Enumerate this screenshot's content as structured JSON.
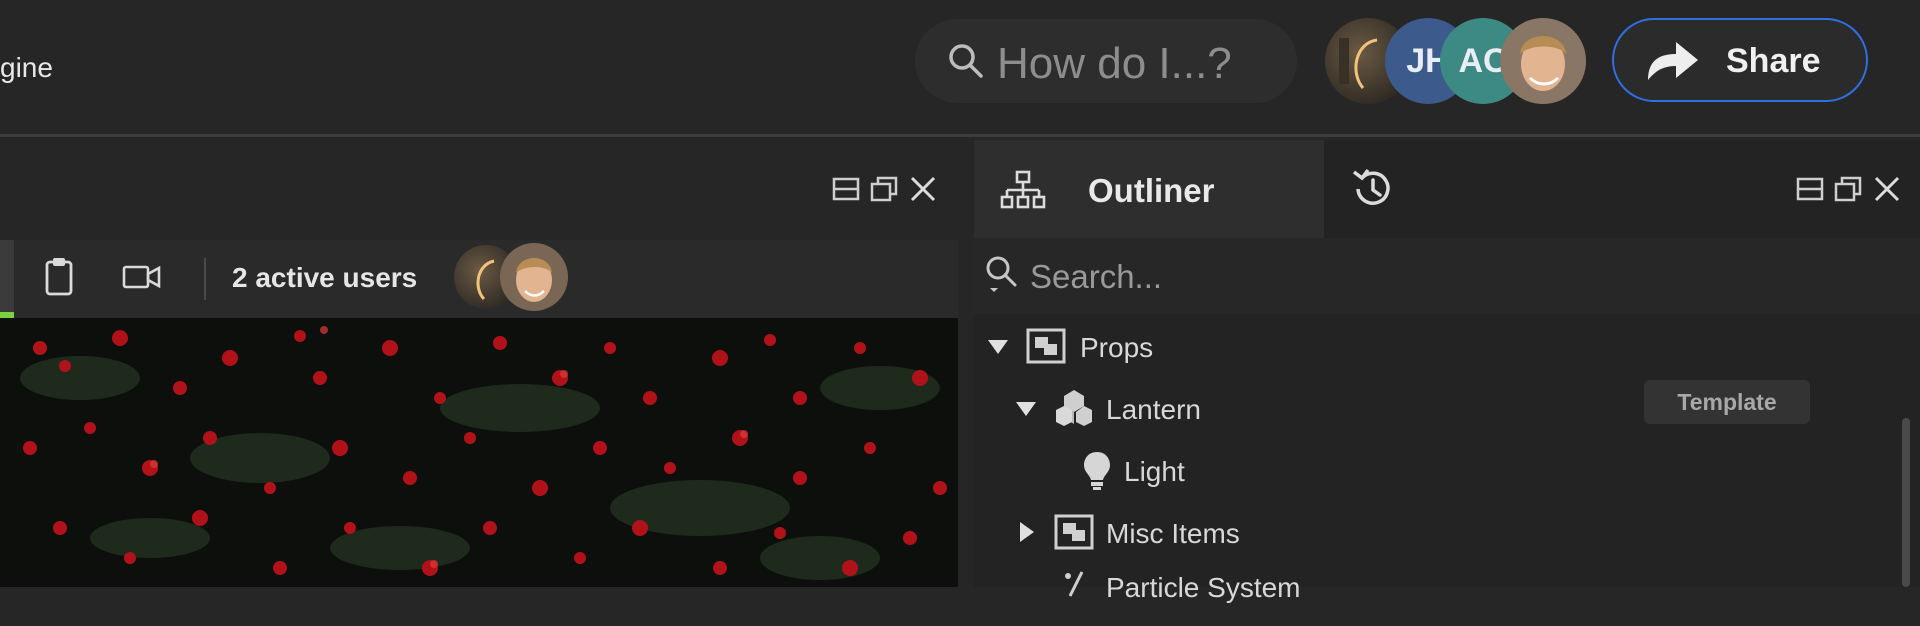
{
  "app": {
    "title_fragment": "gine"
  },
  "topbar": {
    "search_placeholder": "How do I...?",
    "avatars": [
      {
        "kind": "photo",
        "name": "user-photo-1"
      },
      {
        "kind": "initials",
        "text": "JH",
        "color": "#3d5a8c"
      },
      {
        "kind": "initials",
        "text": "AC",
        "color": "#3d8a84"
      },
      {
        "kind": "photo",
        "name": "user-photo-2"
      }
    ],
    "share_label": "Share",
    "accent": "#2f6fe0"
  },
  "viewport_panel": {
    "active_users_label": "2 active users",
    "toolbar_icons": [
      "clipboard-icon",
      "camera-icon"
    ],
    "status_color": "#7bd23d"
  },
  "outliner": {
    "tab_label": "Outliner",
    "search_placeholder": "Search...",
    "tree": [
      {
        "label": "Props",
        "icon": "group-icon",
        "expanded": true,
        "depth": 0
      },
      {
        "label": "Lantern",
        "icon": "template-icon",
        "expanded": true,
        "depth": 1,
        "badge": "Template"
      },
      {
        "label": "Light",
        "icon": "light-bulb-icon",
        "depth": 2
      },
      {
        "label": "Misc Items",
        "icon": "group-icon",
        "expanded": false,
        "depth": 1
      },
      {
        "label": "Particle System",
        "icon": "particle-icon",
        "depth": 1
      }
    ]
  }
}
